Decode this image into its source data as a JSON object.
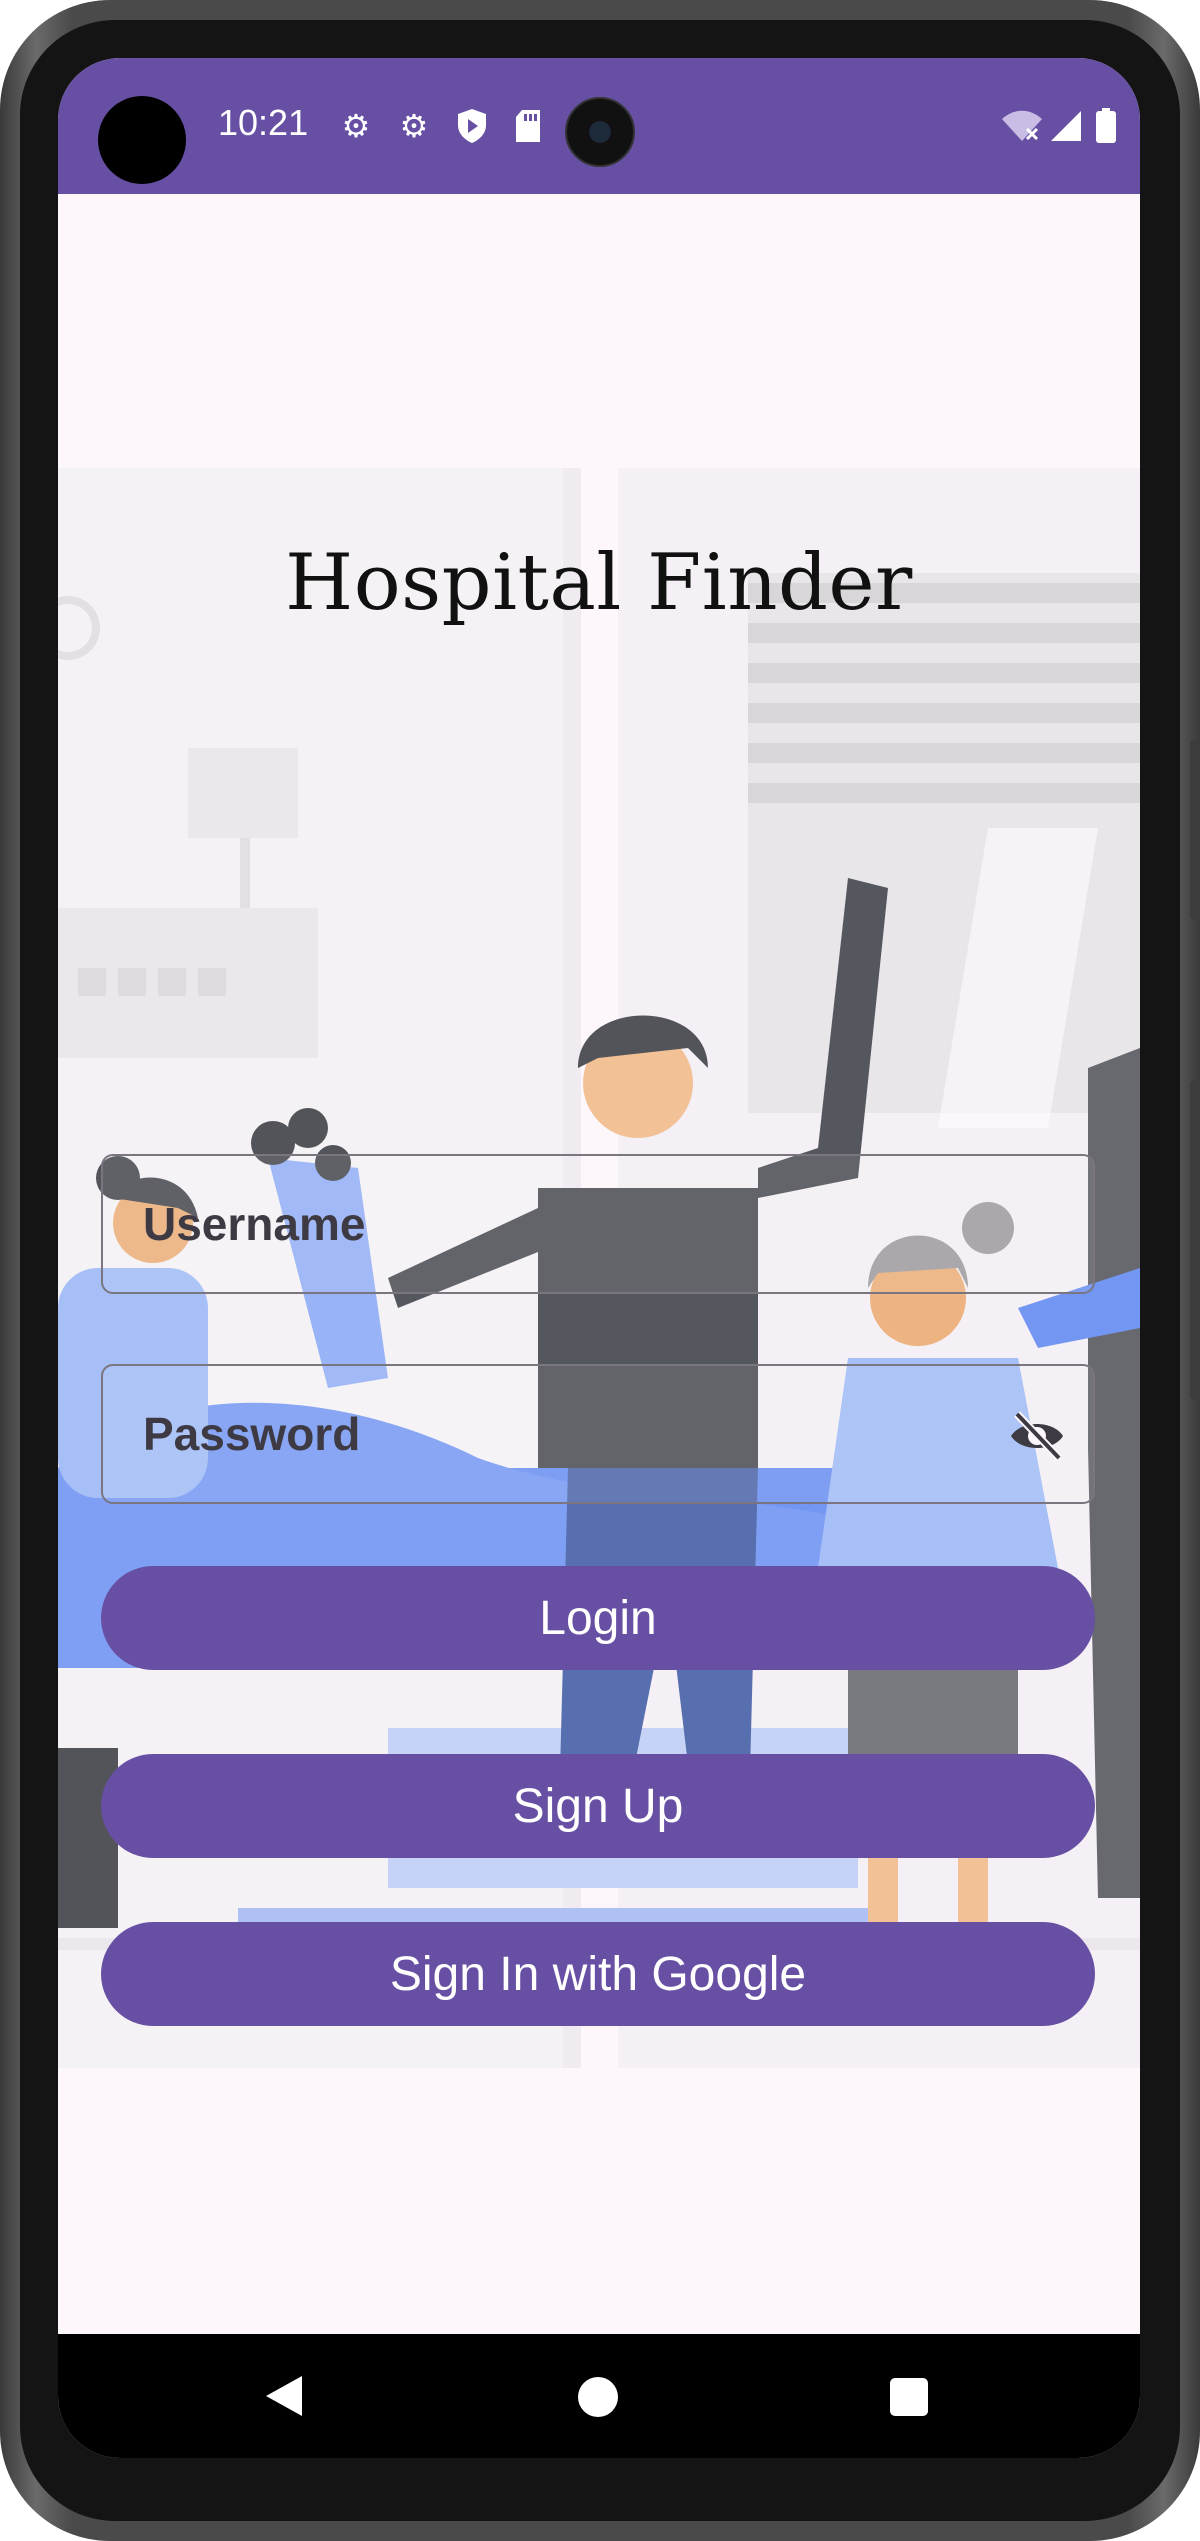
{
  "status_bar": {
    "time": "10:21",
    "left_icons": [
      "gear-icon",
      "gear-icon",
      "shield-play-icon",
      "sd-card-icon"
    ],
    "right_icons": [
      "wifi-off-icon",
      "signal-icon",
      "battery-icon"
    ],
    "color": "#6750a4"
  },
  "app": {
    "title": "Hospital Finder"
  },
  "form": {
    "username_placeholder": "Username",
    "password_placeholder": "Password",
    "password_toggle_icon": "visibility-off-icon"
  },
  "buttons": {
    "login": "Login",
    "signup": "Sign Up",
    "google": "Sign In with Google"
  },
  "colors": {
    "accent": "#6750a4",
    "background": "#fdf7fb"
  },
  "nav_bar": {
    "icons": [
      "back-icon",
      "home-icon",
      "recents-icon"
    ]
  }
}
